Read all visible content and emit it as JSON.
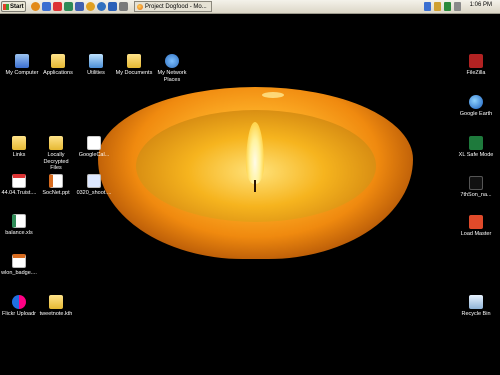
{
  "taskbar": {
    "start_label": "Start",
    "window_title": "Project Dogfood - Mo...",
    "clock": "1:06 PM"
  },
  "icons": {
    "my_computer": "My Computer",
    "applications": "Applications",
    "utilities": "Utilities",
    "my_documents": "My Documents",
    "my_network_places": "My Network Places",
    "links": "Links",
    "locally_decrypted": "Locally Decrypted Files",
    "googlecalendar": "GoogleCal...",
    "truist": "44.04.Truist....",
    "socnet": "SocNet.ppt",
    "shoot": "0320_shoot....",
    "balance": "balance.xls",
    "wlon_badge": "wlon_badge....",
    "flickr": "Flickr Uploadr",
    "tweetnote": "tweetnote.kth",
    "filezilla": "FileZilla",
    "google_earth": "Google Earth",
    "xl_safe_mode": "XL Safe Mode",
    "seventh_son": "7thSon_na...",
    "load_master": "Load Master",
    "recycle_bin": "Recycle Bin"
  },
  "colors": {
    "wallpaper": "#000000",
    "flame": "#fff3a0",
    "wax": "#f6b41e"
  }
}
